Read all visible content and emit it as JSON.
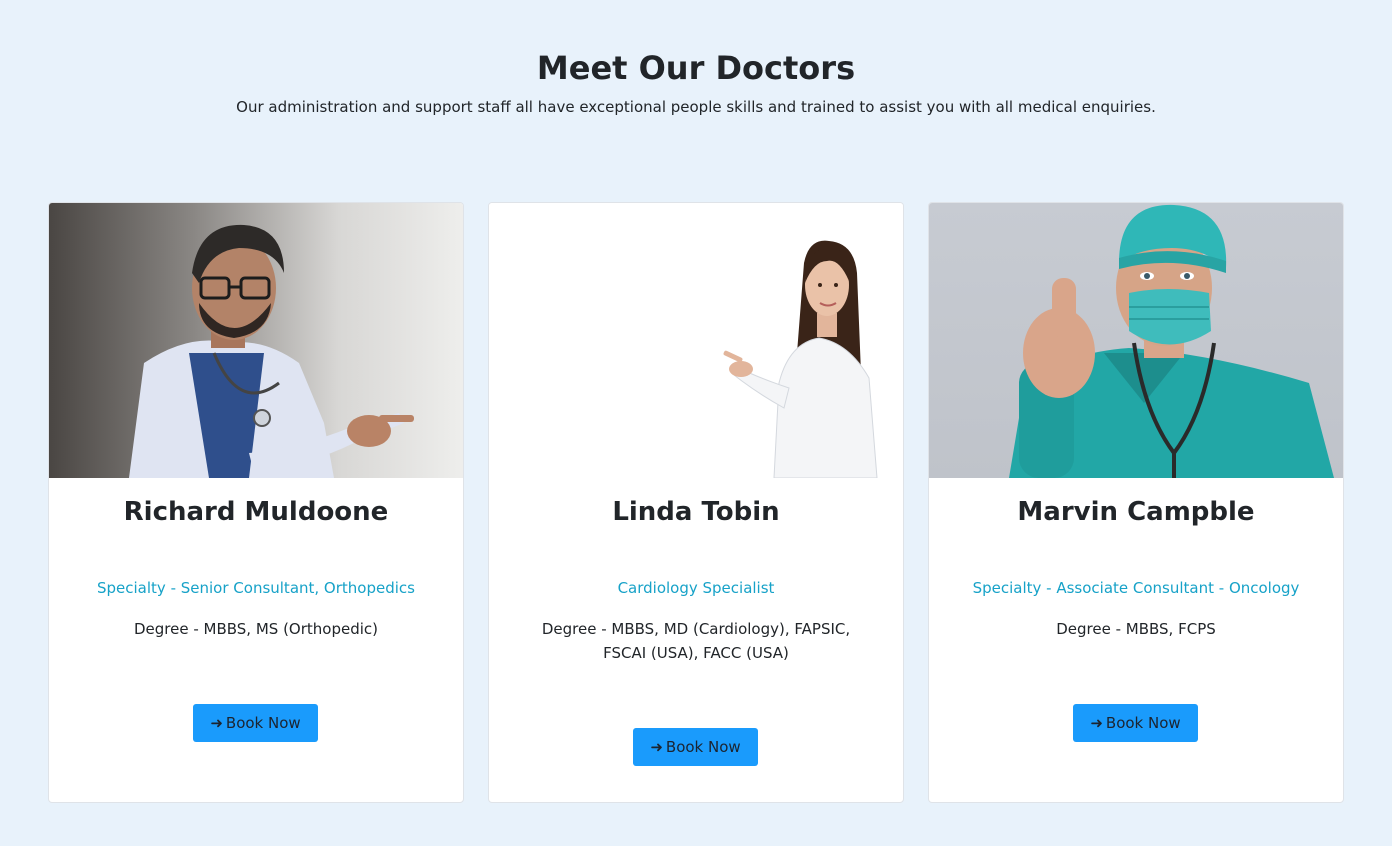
{
  "section": {
    "title": "Meet Our Doctors",
    "subtitle": "Our administration and support staff all have exceptional people skills and trained to assist you with all medical enquiries."
  },
  "doctors": [
    {
      "name": "Richard Muldoone",
      "specialty": "Specialty - Senior Consultant, Orthopedics",
      "degree": "Degree - MBBS, MS (Orthopedic)",
      "button_label": "Book Now",
      "photo": "doctor-pointing-photo"
    },
    {
      "name": "Linda Tobin",
      "specialty": "Cardiology Specialist",
      "degree": "Degree - MBBS, MD (Cardiology), FAPSIC, FSCAI (USA), FACC (USA)",
      "button_label": "Book Now",
      "photo": "doctor-pointing-photo"
    },
    {
      "name": "Marvin Campble",
      "specialty": "Specialty - Associate Consultant - Oncology",
      "degree": "Degree - MBBS, FCPS",
      "button_label": "Book Now",
      "photo": "surgeon-thumbs-up-photo"
    }
  ],
  "icons": {
    "button_icon": "arrow-right-icon"
  },
  "colors": {
    "page_background": "#e8f2fb",
    "accent": "#17a2c8",
    "button": "#1a9bfc"
  }
}
